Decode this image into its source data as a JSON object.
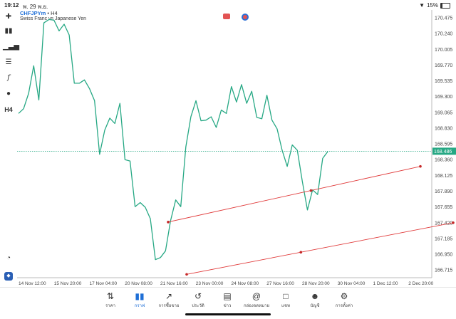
{
  "status_bar": {
    "time": "19:12",
    "date": "พ. 29 พ.ย.",
    "battery": "15%"
  },
  "header": {
    "symbol": "CHFJPYm",
    "timeframe": "H4",
    "description": "Swiss Franc vs Japanese Yen"
  },
  "toolbar": {
    "timeframe_label": "H4",
    "icons": [
      "crosshair-icon",
      "candles-icon",
      "bars-icon",
      "indicators-icon",
      "function-icon",
      "objects-icon",
      "timeframe-icon",
      "speedometer-icon",
      "app-logo-icon"
    ]
  },
  "chart_data": {
    "type": "line",
    "current_price": "168.486",
    "y_ticks": [
      "170.475",
      "170.240",
      "170.005",
      "169.770",
      "169.535",
      "169.300",
      "169.065",
      "168.830",
      "168.595",
      "168.360",
      "168.125",
      "167.890",
      "167.655",
      "167.420",
      "167.185",
      "166.950",
      "166.715"
    ],
    "x_ticks": [
      "14 Nov 12:00",
      "15 Nov 20:00",
      "17 Nov 04:00",
      "20 Nov 08:00",
      "21 Nov 16:00",
      "23 Nov 00:00",
      "24 Nov 08:00",
      "27 Nov 16:00",
      "28 Nov 20:00",
      "30 Nov 04:00",
      "1 Dec 12:00",
      "2 Dec 20:00"
    ],
    "series": [
      {
        "values": [
          169.05,
          169.12,
          169.35,
          169.76,
          169.25,
          170.4,
          170.45,
          170.44,
          170.28,
          170.38,
          170.22,
          169.5,
          169.5,
          169.55,
          169.42,
          169.24,
          168.44,
          168.8,
          168.98,
          168.9,
          169.2,
          168.36,
          168.34,
          167.66,
          167.72,
          167.65,
          167.48,
          166.87,
          166.9,
          167.0,
          167.45,
          167.76,
          167.66,
          168.55,
          169.0,
          169.24,
          168.94,
          168.95,
          169.0,
          168.84,
          169.1,
          169.05,
          169.45,
          169.22,
          169.48,
          169.2,
          169.38,
          168.99,
          168.97,
          169.32,
          168.95,
          168.82,
          168.5,
          168.26,
          168.58,
          168.5,
          168.03,
          167.61,
          167.91,
          167.84,
          168.38,
          168.48
        ],
        "color": "#26a884"
      }
    ],
    "trendlines": [
      {
        "from": [
          167.43,
          "21 Nov 08:00"
        ],
        "to": [
          168.26,
          "2 Dec 00:00"
        ],
        "mid": 167.9,
        "color": "#e03a3a"
      },
      {
        "from": [
          166.65,
          "21 Nov 16:00"
        ],
        "to": [
          167.42,
          "2 Dec 16:00"
        ],
        "mid": 166.98,
        "color": "#e03a3a"
      }
    ],
    "ylim": [
      166.6,
      170.55
    ],
    "grid": false
  },
  "nav": [
    {
      "label": "ราคา",
      "icon": "quotes-icon"
    },
    {
      "label": "กราฟ",
      "icon": "chart-icon",
      "active": true
    },
    {
      "label": "การซื้อขาย",
      "icon": "trade-icon"
    },
    {
      "label": "ประวัติ",
      "icon": "history-icon"
    },
    {
      "label": "ข่าว",
      "icon": "news-icon"
    },
    {
      "label": "กล่องจดหมาย",
      "icon": "mailbox-icon"
    },
    {
      "label": "แชท",
      "icon": "chat-icon"
    },
    {
      "label": "บัญชี",
      "icon": "account-icon"
    },
    {
      "label": "การตั้งค่า",
      "icon": "settings-icon"
    }
  ]
}
